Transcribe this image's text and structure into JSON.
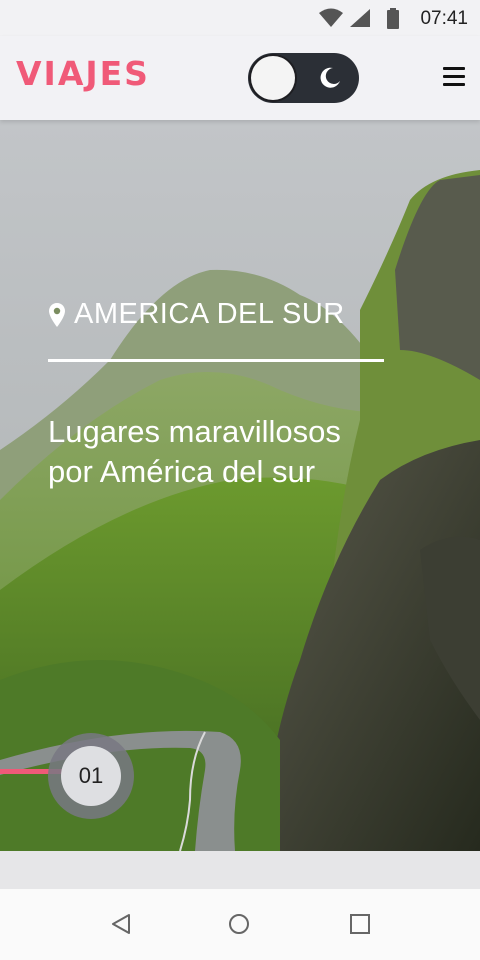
{
  "status_bar": {
    "time": "07:41",
    "icons": [
      "wifi-icon",
      "signal-icon",
      "battery-icon"
    ]
  },
  "header": {
    "logo": "VIAJES",
    "toggle": {
      "icon": "moon-icon",
      "state": "light"
    },
    "menu_icon": "hamburger-menu-icon"
  },
  "hero": {
    "location_icon": "map-pin-icon",
    "location": "AMERICA DEL SUR",
    "title_line1": "Lugares maravillosos",
    "title_line2": "por América del sur",
    "slide_number": "01"
  },
  "colors": {
    "accent": "#f05a78",
    "toggle_bg": "#2b2f36",
    "header_bg": "#f2f2f5"
  },
  "nav": {
    "buttons": [
      "back-icon",
      "home-icon",
      "recents-icon"
    ]
  }
}
